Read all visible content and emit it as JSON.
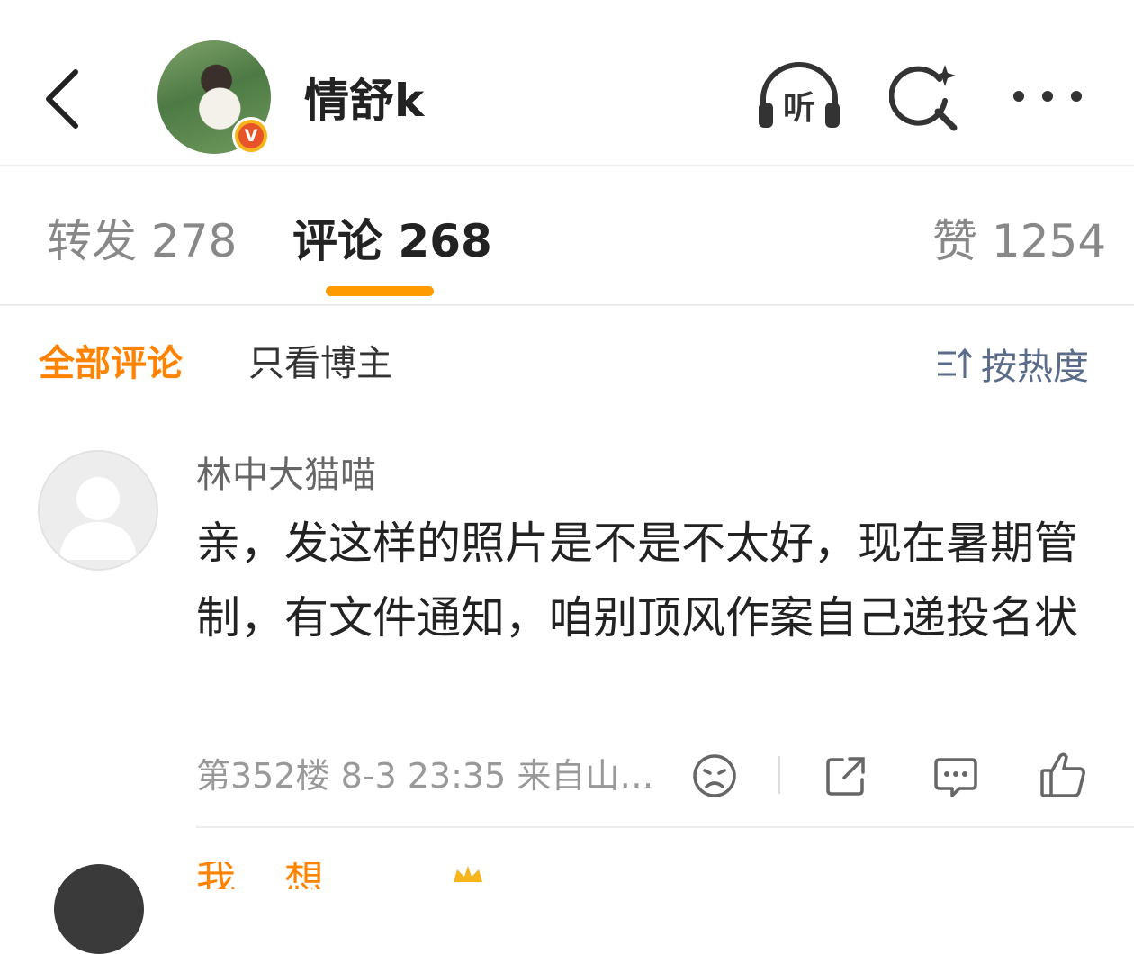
{
  "header": {
    "back_icon": "chevron-left-icon",
    "username": "情舒k",
    "verified_badge": "V",
    "listen_label": "听",
    "search_icon": "search-sparkle-icon",
    "more_icon": "more-dots-icon"
  },
  "tabs": {
    "repost": "转发 278",
    "comment": "评论 268",
    "like": "赞 1254",
    "active_color": "#ff9a00"
  },
  "filters": {
    "all": "全部评论",
    "owner_only": "只看博主",
    "sort": "按热度",
    "active_color": "#ff8200"
  },
  "comment": {
    "author": "林中大猫喵",
    "text": "亲，发这样的照片是不是不太好，现在暑期管制，有文件通知，咱别顶风作案自己递投名状",
    "meta": "第352楼  8-3 23:35  来自山…",
    "actions": [
      "dislike-icon",
      "share-icon",
      "reply-icon",
      "like-icon"
    ]
  },
  "next_comment": {
    "author_partial": "我 想 要 ..."
  }
}
